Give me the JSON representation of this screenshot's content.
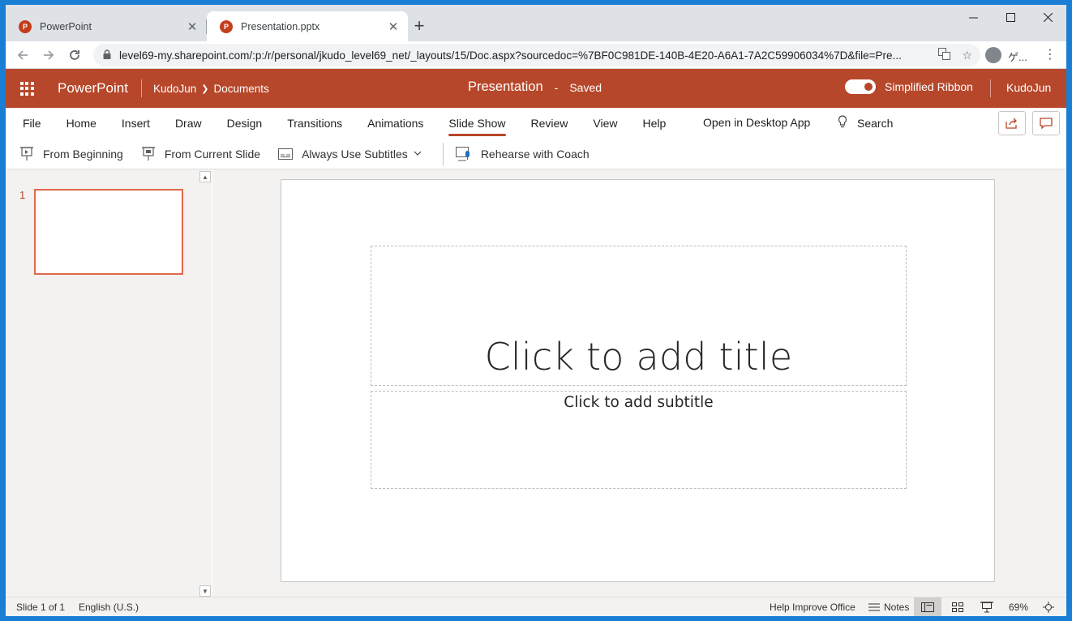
{
  "browser": {
    "tabs": [
      {
        "title": "PowerPoint",
        "favicon": "P"
      },
      {
        "title": "Presentation.pptx",
        "favicon": "P"
      }
    ],
    "url": "level69-my.sharepoint.com/:p:/r/personal/jkudo_level69_net/_layouts/15/Doc.aspx?sourcedoc=%7BF0C981DE-140B-4E20-A6A1-7A2C59906034%7D&file=Pre...",
    "profile_label": "ゲ..."
  },
  "header": {
    "app_name": "PowerPoint",
    "breadcrumb_owner": "KudoJun",
    "breadcrumb_folder": "Documents",
    "doc_title": "Presentation",
    "separator": "-",
    "save_status": "Saved",
    "simplified_ribbon_label": "Simplified Ribbon",
    "user_name": "KudoJun",
    "accent_color": "#b7472a"
  },
  "ribbon": {
    "tabs": [
      "File",
      "Home",
      "Insert",
      "Draw",
      "Design",
      "Transitions",
      "Animations",
      "Slide Show",
      "Review",
      "View",
      "Help"
    ],
    "active_tab": "Slide Show",
    "open_desktop": "Open in Desktop App",
    "search_label": "Search",
    "commands": {
      "from_beginning": "From Beginning",
      "from_current": "From Current Slide",
      "subtitles": "Always Use Subtitles",
      "rehearse": "Rehearse with Coach"
    }
  },
  "thumbnails": {
    "slide_number": "1"
  },
  "slide": {
    "title_placeholder": "Click to add title",
    "subtitle_placeholder": "Click to add subtitle"
  },
  "status": {
    "slide_count": "Slide 1 of 1",
    "language": "English (U.S.)",
    "help_improve": "Help Improve Office",
    "notes": "Notes",
    "zoom": "69%"
  }
}
